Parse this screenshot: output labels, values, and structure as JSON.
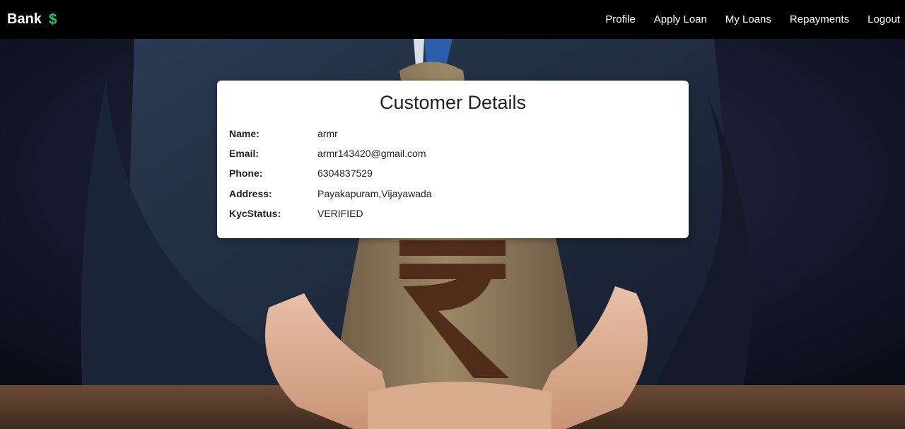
{
  "navbar": {
    "brand": "Bank",
    "brand_icon": "$",
    "links": [
      "Profile",
      "Apply Loan",
      "My Loans",
      "Repayments",
      "Logout"
    ]
  },
  "card": {
    "title": "Customer Details",
    "rows": [
      {
        "label": "Name:",
        "value": "armr"
      },
      {
        "label": "Email:",
        "value": "armr143420@gmail.com"
      },
      {
        "label": "Phone:",
        "value": "6304837529"
      },
      {
        "label": "Address:",
        "value": "Payakapuram,Vijayawada"
      },
      {
        "label": "KycStatus:",
        "value": "VERIFIED"
      }
    ]
  },
  "background": {
    "description_icon": "money-bag-rupee-photo",
    "colors": {
      "bag": "#8a7558",
      "rupee": "#4a2414",
      "suit": "#1f2a3e",
      "table": "#5a3d2b"
    }
  }
}
